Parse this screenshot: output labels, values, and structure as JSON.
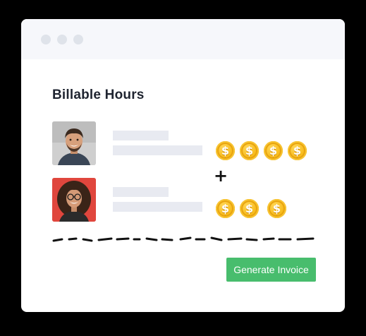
{
  "card": {
    "title": "Billable Hours"
  },
  "entries": [
    {
      "avatar": "man-smiling-avatar",
      "coins": 4
    },
    {
      "avatar": "woman-curly-hair-avatar",
      "coins": 3
    }
  ],
  "coin": {
    "icon": "dollar-coin-icon",
    "symbol": "$",
    "color": "#f7b916"
  },
  "operator": {
    "symbol": "+"
  },
  "actions": {
    "generate_label": "Generate Invoice"
  },
  "colors": {
    "accent": "#48bd6d",
    "placeholder": "#e8eaf1",
    "titlebar": "#f6f7fb"
  }
}
